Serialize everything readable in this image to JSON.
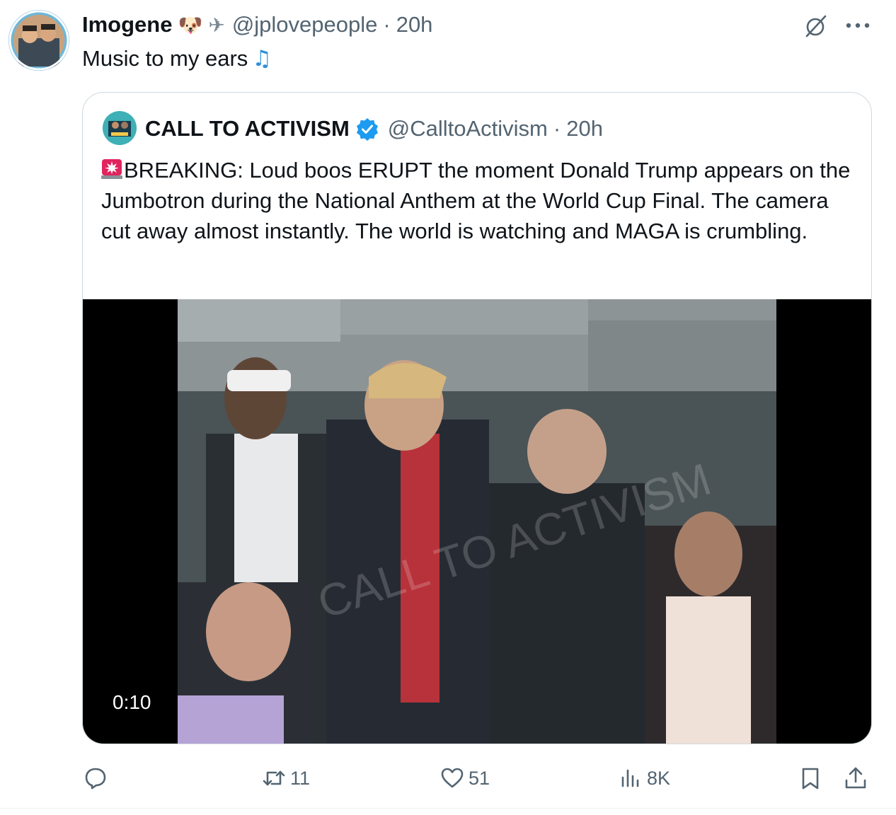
{
  "tweet": {
    "author_name": "Imogene",
    "emojis": [
      "🐶",
      "✈"
    ],
    "handle": "@jplovepeople",
    "separator": "·",
    "time": "20h",
    "text": "Music to my ears",
    "text_emoji": "♫"
  },
  "quoted_tweet": {
    "author_name": "CALL TO ACTIVISM",
    "handle": "@CalltoActivism",
    "separator": "·",
    "time": "20h",
    "text": "BREAKING: Loud boos ERUPT the moment Donald Trump appears on the Jumbotron during the National Anthem at the World Cup Final. The camera cut away almost instantly. The world is watching and MAGA is crumbling.",
    "video": {
      "duration": "0:10",
      "watermark": "CALL TO ACTIVISM"
    }
  },
  "actions": {
    "replies": "",
    "retweets": "11",
    "likes": "51",
    "views": "8K"
  },
  "colors": {
    "text": "#0f1419",
    "secondary": "#536471",
    "border": "#cfd9de",
    "verified": "#1d9bf0"
  }
}
